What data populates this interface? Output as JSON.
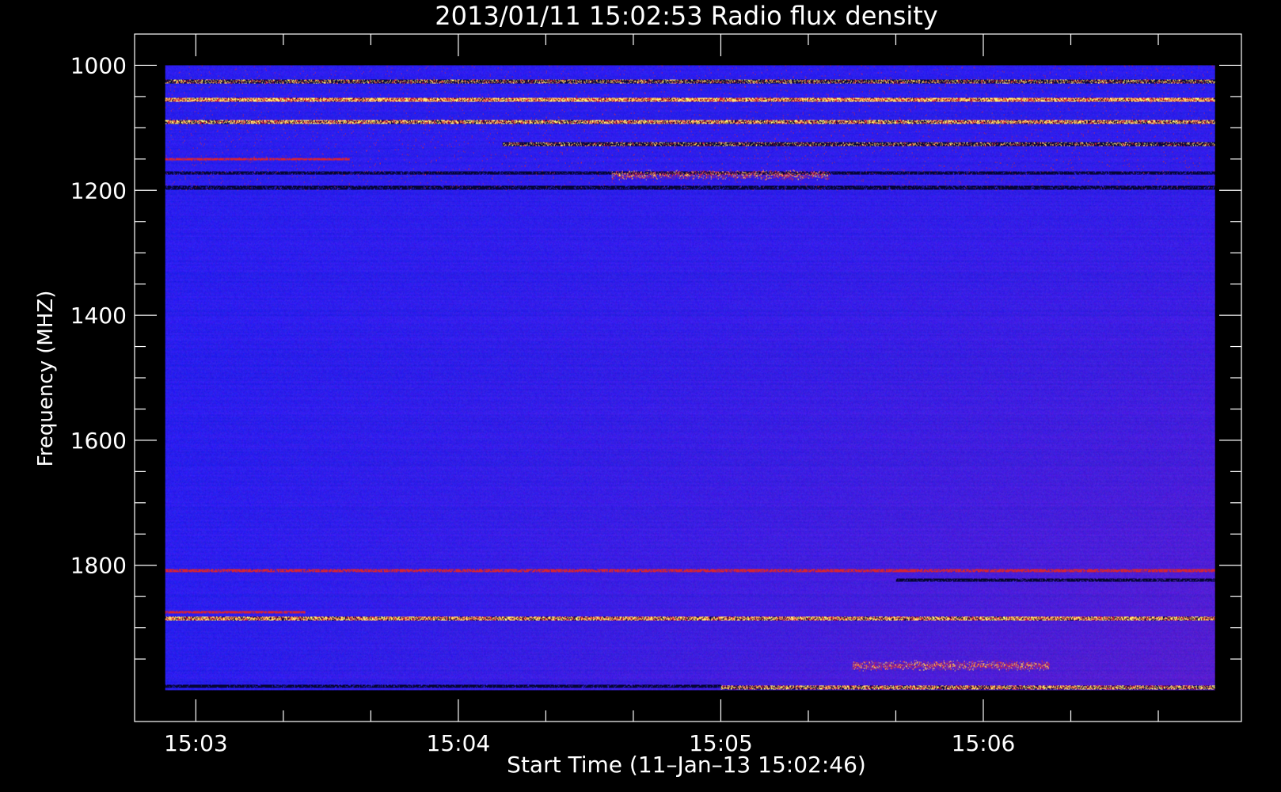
{
  "chart_data": {
    "type": "heatmap",
    "title": "2013/01/11 15:02:53 Radio flux density",
    "xlabel": "Start Time (11–Jan–13 15:02:46)",
    "ylabel": "Frequency (MHZ)",
    "x_axis": {
      "unit": "time",
      "range": [
        "15:02:46",
        "15:06:59"
      ],
      "data_extent": [
        "15:02:53",
        "15:06:53"
      ],
      "major_ticks": [
        "15:03",
        "15:04",
        "15:05",
        "15:06"
      ],
      "minor_ticks": [
        "15:03:20",
        "15:03:40",
        "15:04:20",
        "15:04:40",
        "15:05:20",
        "15:05:40",
        "15:06:20",
        "15:06:40"
      ]
    },
    "y_axis": {
      "unit": "MHz",
      "range": [
        950,
        2050
      ],
      "inverted": true,
      "data_extent": [
        1000,
        2000
      ],
      "major_ticks": [
        1000,
        1200,
        1400,
        1600,
        1800
      ],
      "minor_ticks": [
        1050,
        1100,
        1150,
        1250,
        1300,
        1350,
        1450,
        1500,
        1550,
        1650,
        1700,
        1750,
        1850,
        1900,
        1950
      ]
    },
    "colormap": {
      "low": "#0a0ab4",
      "background": "#1e1ef0",
      "mid": "#b41e3c",
      "high": "#ffdc50",
      "dark_band": "#000030"
    },
    "features": [
      {
        "kind": "bright_band",
        "freq": 1055,
        "t_start": "15:02:53",
        "t_end": "15:06:53",
        "intensity": 1.0
      },
      {
        "kind": "bright_band",
        "freq": 1090,
        "t_start": "15:02:53",
        "t_end": "15:06:53",
        "intensity": 0.8
      },
      {
        "kind": "bright_band",
        "freq": 1025,
        "t_start": "15:02:53",
        "t_end": "15:06:53",
        "intensity": 0.45
      },
      {
        "kind": "bright_band",
        "freq": 1125,
        "t_start": "15:04:10",
        "t_end": "15:06:53",
        "intensity": 0.35
      },
      {
        "kind": "red_line",
        "freq": 1150,
        "t_start": "15:02:53",
        "t_end": "15:03:35",
        "intensity": 0.7
      },
      {
        "kind": "dark_band",
        "freq": 1172,
        "t_start": "15:02:53",
        "t_end": "15:06:53"
      },
      {
        "kind": "dark_band",
        "freq": 1195,
        "t_start": "15:02:53",
        "t_end": "15:06:53"
      },
      {
        "kind": "burst_patch",
        "freq": 1175,
        "t_start": "15:04:35",
        "t_end": "15:05:25",
        "intensity": 0.6
      },
      {
        "kind": "red_line",
        "freq": 1808,
        "t_start": "15:02:53",
        "t_end": "15:06:53",
        "intensity": 0.6
      },
      {
        "kind": "dark_band",
        "freq": 1823,
        "t_start": "15:05:40",
        "t_end": "15:06:53"
      },
      {
        "kind": "red_line",
        "freq": 1875,
        "t_start": "15:02:53",
        "t_end": "15:03:25",
        "intensity": 0.7
      },
      {
        "kind": "bright_band",
        "freq": 1885,
        "t_start": "15:02:53",
        "t_end": "15:06:53",
        "intensity": 0.85
      },
      {
        "kind": "burst_patch",
        "freq": 1960,
        "t_start": "15:05:30",
        "t_end": "15:06:15",
        "intensity": 0.7
      },
      {
        "kind": "bright_band",
        "freq": 1995,
        "t_start": "15:05:00",
        "t_end": "15:06:53",
        "intensity": 0.75
      },
      {
        "kind": "dark_band",
        "freq": 1993,
        "t_start": "15:02:53",
        "t_end": "15:05:00"
      }
    ]
  }
}
